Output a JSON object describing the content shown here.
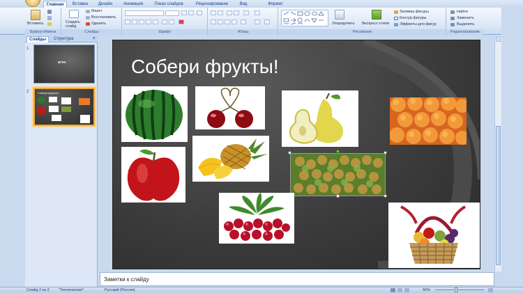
{
  "ribbon": {
    "tabs": [
      "Главная",
      "Вставка",
      "Дизайн",
      "Анимация",
      "Показ слайдов",
      "Рецензирование",
      "Вид",
      "Формат"
    ],
    "active_tab": "Главная",
    "clipboard": {
      "paste": "Вставить",
      "group": "Буфер обмена"
    },
    "slides": {
      "new_slide": "Создать слайд",
      "layout": "Макет",
      "reset": "Восстановить",
      "delete": "Удалить",
      "group": "Слайды"
    },
    "font": {
      "group": "Шрифт"
    },
    "paragraph": {
      "group": "Абзац"
    },
    "drawing": {
      "arrange": "Упорядочить",
      "quick_styles": "Экспресс-стили",
      "fill": "Заливка фигуры",
      "outline": "Контур фигуры",
      "effects": "Эффекты для фигур",
      "group": "Рисование"
    },
    "editing": {
      "find": "Найти",
      "replace": "Заменить",
      "select": "Выделить",
      "group": "Редактирование"
    }
  },
  "panel": {
    "tabs": [
      "Слайды",
      "Структура"
    ],
    "close": "×",
    "thumbnails": [
      {
        "number": "1",
        "title": "ИГРА"
      },
      {
        "number": "2",
        "title": "Собери фрукты!"
      }
    ]
  },
  "slide": {
    "title": "Собери фрукты!",
    "images": [
      "Арбуз",
      "Вишня",
      "Груша",
      "Персики",
      "Яблоко",
      "Ананас",
      "Виноград",
      "Ягоды",
      "Корзина с фруктами"
    ]
  },
  "notes": {
    "placeholder": "Заметки к слайду"
  },
  "status": {
    "slide_counter": "Слайд 2 из 2",
    "theme": "\"Техническая\"",
    "language": "Русский (Россия)",
    "zoom": "66%"
  },
  "colors": {
    "ribbon": "#dbe7f6",
    "slide_bg": "#3a3a3a",
    "selection": "#f2a630"
  }
}
